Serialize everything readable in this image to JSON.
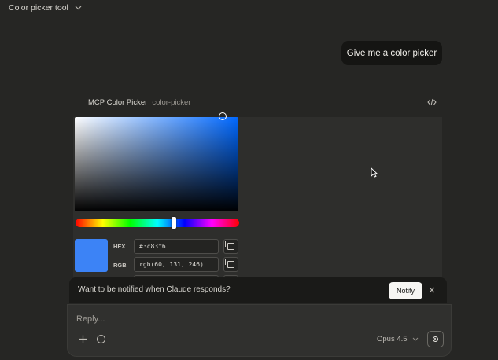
{
  "header": {
    "title": "Color picker tool",
    "menu_icon": "chevron-down-icon"
  },
  "conversation": {
    "user_message": "Give me a color picker"
  },
  "artifact": {
    "name": "MCP Color Picker",
    "id": "color-picker",
    "code_icon": "code-icon",
    "picker": {
      "hue_position": 0.6,
      "selected_color": "#3c83f6",
      "hex_label": "HEX",
      "hex_value": "#3c83f6",
      "rgb_label": "RGB",
      "rgb_value": "rgb(60, 131, 246)"
    }
  },
  "notification": {
    "text": "Want to be notified when Claude responds?",
    "button_label": "Notify",
    "close_icon": "close-icon"
  },
  "composer": {
    "placeholder": "Reply...",
    "model_label": "Opus 4.5"
  }
}
